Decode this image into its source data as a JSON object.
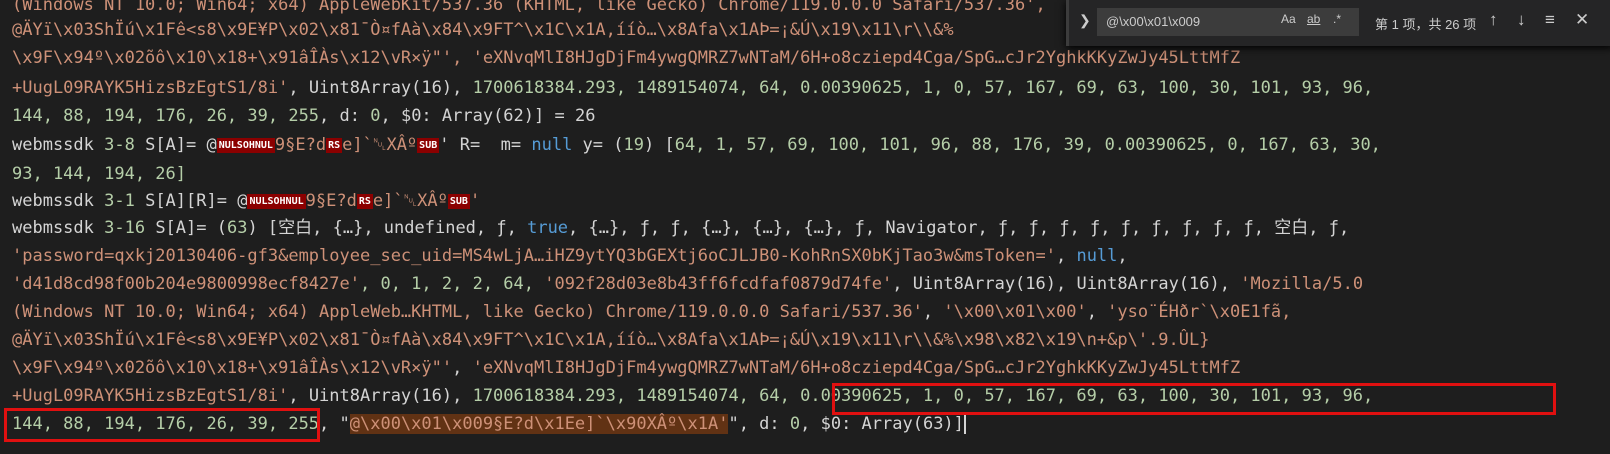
{
  "console": {
    "line1": "(Windows NT 10.0; Win64; x64) AppleWebKit/537.36 (KHTML, like Gecko) Chrome/119.0.0.0 Safari/537.36',",
    "line2": "@ÄYï\\x03ShÏú\\x1Fê<s8\\x9E¥P\\x02\\x81¯Ò¤fAà\\x84\\x9FT^\\x1C\\x1A,ííò…\\x8Afa\\x1AÞ=¡&Ú\\x19\\x11\\r\\\\&%",
    "line3_a": "\\x9F\\x94º\\x02õô\\x10\\x18+\\x91âÎÀs\\x12\\vR×ÿ\"', ",
    "line3_b": "'eXNvqMlI8HJgDjFm4ywgQMRZ7wNTaM/6H+o8cziepd4Cga/SpG…cJr2YghkKKyZwJy45LttMfZ",
    "line4_a": "+UugL09RAYK5HizsBzEgtS1/8i'",
    "line4_b": ", Uint8Array(16), ",
    "line4_c": "1700618384.293, 1489154074, 64, 0.00390625, 1, 0, 57, 167, 69, 63, 100, 30, 101, 93, 96,",
    "line5_a": "144, 88, 194, 176, 26, 39, 255",
    "line5_b": ", d: ",
    "line5_c": "0",
    "line5_d": ", $0: Array(62)] = ",
    "line5_e": "26",
    "line6_a": "webmssdk ",
    "line6_b": "3-8",
    "line6_c": " S[A]= @",
    "line6_d": "9§E?d",
    "line6_e": "e]`␀XÂº",
    "line6_f": "' R=  m= ",
    "line6_g": "null",
    "line6_h": " y= (",
    "line6_i": "19",
    "line6_j": ") [",
    "line6_k": "64, 1, 57, 69, 100, 101, 96, 88, 176, 39, 0.00390625, 0, 167, 63, 30,",
    "line7": "93, 144, 194, 26]",
    "line8_a": "webmssdk ",
    "line8_b": "3-1",
    "line8_c": " S[A][R]= @",
    "line8_d": "9§E?d",
    "line8_e": "e]`␀XÂº",
    "line8_f": "'",
    "line9_a": "webmssdk ",
    "line9_b": "3-16",
    "line9_c": " S[A]= (",
    "line9_d": "63",
    "line9_e": ") [空白, {…}, undefined, ƒ, ",
    "line9_f": "true",
    "line9_g": ", {…}, ƒ, ƒ, {…}, {…}, {…}, ƒ, Navigator, ƒ, ƒ, ƒ, ƒ, ƒ, ƒ, ƒ, ƒ, ƒ, 空白, ƒ,",
    "line10_a": "'password=qxkj20130406-gf3&employee_sec_uid=MS4wLjA…iHZ9ytYQ3bGEXtj6oCJLJB0-KohRnSX0bKjTao3w&msToken='",
    "line10_b": ", ",
    "line10_c": "null",
    "line10_d": ",",
    "line11_a": "'d41d8cd98f00b204e9800998ecf8427e'",
    "line11_b": ", 0, 1, 2, 2, 64, ",
    "line11_c": "'092f28d03e8b43ff6fcdfaf0879d74fe'",
    "line11_d": ", Uint8Array(16), Uint8Array(16), ",
    "line11_e": "'Mozilla/5.0",
    "line12_a": "(Windows NT 10.0; Win64; x64) AppleWeb…KHTML, like Gecko) Chrome/119.0.0.0 Safari/537.36'",
    "line12_b": ", ",
    "line12_c": "'\\x00\\x01\\x00'",
    "line12_d": ", ",
    "line12_e": "'yso¨ÉHðr`\\x0E1fã,",
    "line13": "@ÄYï\\x03ShÏú\\x1Fê<s8\\x9E¥P\\x02\\x81¯Ò¤fAà\\x84\\x9FT^\\x1C\\x1A,ííò…\\x8Afa\\x1AÞ=¡&Ú\\x19\\x11\\r\\\\&%\\x98\\x82\\x19\\n+&p\\'.9.ÛL}",
    "line14_a": "\\x9F\\x94º\\x02õô\\x10\\x18+\\x91âÎÀs\\x12\\vR×ÿ\"'",
    "line14_b": ", ",
    "line14_c": "'eXNvqMlI8HJgDjFm4ywgQMRZ7wNTaM/6H+o8cziepd4Cga/SpG…cJr2YghkKKyZwJy45LttMfZ",
    "line15_a": "+UugL09RAYK5HizsBzEgtS1/8i'",
    "line15_b": ", Uint8Array(16), ",
    "line15_c": "1700618384.293, 1489154074, 64, 0.00390625, 1, 0, 57, 167, 69, 63, 100, 30, 101, 93, 96,",
    "line16_a": "144, 88, 194, 176, 26, 39, 255",
    "line16_b": ", \"",
    "line16_c": "@\\x00\\x01\\x009§E?d\\x1Ee]`\\x90XÂº\\x1A'",
    "line16_d": "\", d: ",
    "line16_e": "0",
    "line16_f": ", $0: Array(63)]",
    "ctl_nulsohnul": "NULSOHNUL",
    "ctl_rs": "RS",
    "ctl_sub": "SUB"
  },
  "find": {
    "query": "@\\x00\\x01\\x009",
    "opt_case": "Aa",
    "opt_word": "ab",
    "opt_regex": ".*",
    "count": "第 1 项，共 26 项",
    "icons": [
      "chevron-right-icon",
      "arrow-up-icon",
      "arrow-down-icon",
      "hamburger-icon",
      "close-icon"
    ]
  }
}
